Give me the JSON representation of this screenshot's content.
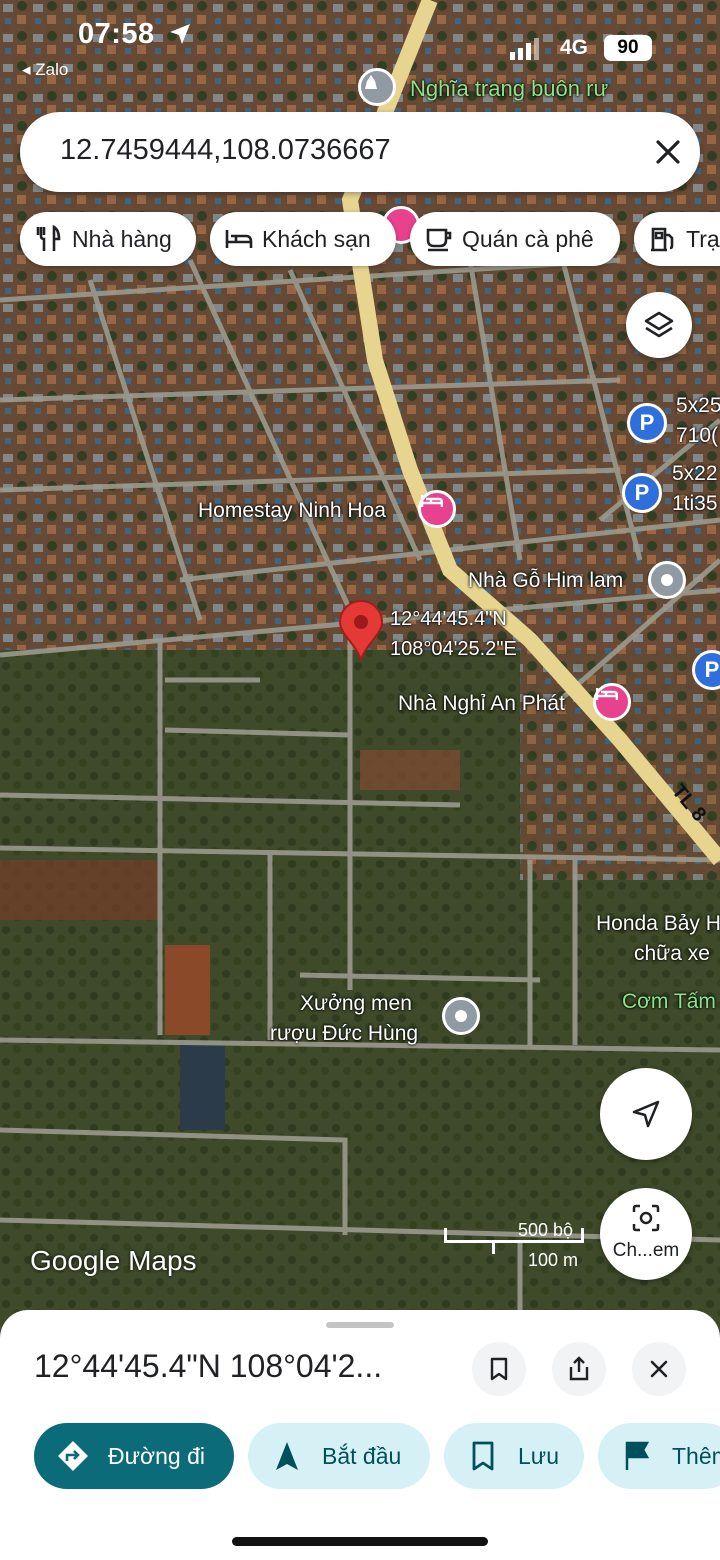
{
  "status_bar": {
    "time": "07:58",
    "back_app": "Zalo",
    "network": "4G",
    "battery": "90"
  },
  "search": {
    "query": "12.7459444,108.0736667"
  },
  "chips": [
    {
      "label": "Nhà hàng",
      "icon": "restaurant-icon"
    },
    {
      "label": "Khách sạn",
      "icon": "hotel-icon"
    },
    {
      "label": "Quán cà phê",
      "icon": "coffee-icon"
    },
    {
      "label": "Trạ",
      "icon": "gas-station-icon"
    }
  ],
  "map": {
    "labels": {
      "cemetery": "Nghĩa trang buôn rư",
      "homestay": "Homestay Ninh Hoa",
      "wood_house": "Nhà Gỗ Him lam",
      "coord_lat": "12°44'45.4\"N",
      "coord_lng": "108°04'25.2\"E",
      "guesthouse": "Nhà Nghỉ An Phát",
      "parking_1a": "5x25",
      "parking_1b": "710(",
      "parking_2a": "5x22",
      "parking_2b": "1ti35",
      "road": "TL 8",
      "honda_1": "Honda Bảy H",
      "honda_2": "chữa xe",
      "com_tam": "Cơm Tấm",
      "xuong_1": "Xưởng men",
      "xuong_2": "rượu Đức Hùng"
    },
    "branding": "Google Maps",
    "scale_imperial": "500 bộ",
    "scale_metric": "100 m",
    "lens_label": "Ch...em"
  },
  "sheet": {
    "title": "12°44'45.4\"N 108°04'2...",
    "actions": [
      {
        "label": "Đường đi",
        "icon": "directions-icon"
      },
      {
        "label": "Bắt đầu",
        "icon": "navigation-start-icon"
      },
      {
        "label": "Lưu",
        "icon": "bookmark-icon"
      },
      {
        "label": "Thêm",
        "icon": "flag-icon"
      }
    ]
  },
  "colors": {
    "accent_teal": "#0b6b78",
    "action_bg": "#d6f1f5",
    "pin_red": "#e53935",
    "poi_pink": "#e8418d",
    "parking_blue": "#2f6fdb"
  }
}
